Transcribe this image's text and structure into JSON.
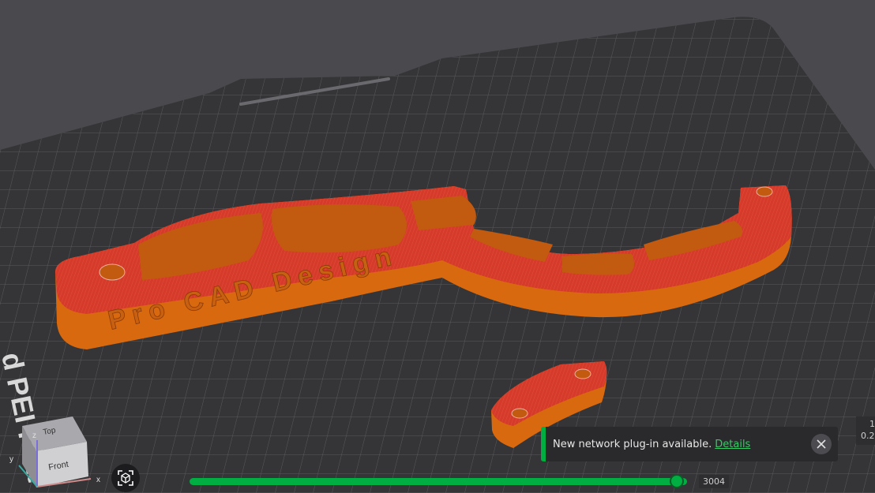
{
  "canvas": {
    "plate_label": "d PEI Plat",
    "model_text": "Pro CAD Design",
    "colors": {
      "background": "#4a4a4e",
      "plate": "#353537",
      "model_face": "#d9382b",
      "model_side": "#d9690e",
      "accent": "#00ae42"
    }
  },
  "view_cube": {
    "top_label": "Top",
    "front_label": "Front",
    "axis_x": "x",
    "axis_y": "y",
    "axis_z": "z"
  },
  "notification": {
    "message": "New network plug-in available.",
    "link_label": "Details",
    "close_icon": "close-icon"
  },
  "layer_slider": {
    "value_label": "3004",
    "progress": 0.98
  },
  "right_readout": {
    "line1": "1",
    "line2": "0.2"
  }
}
